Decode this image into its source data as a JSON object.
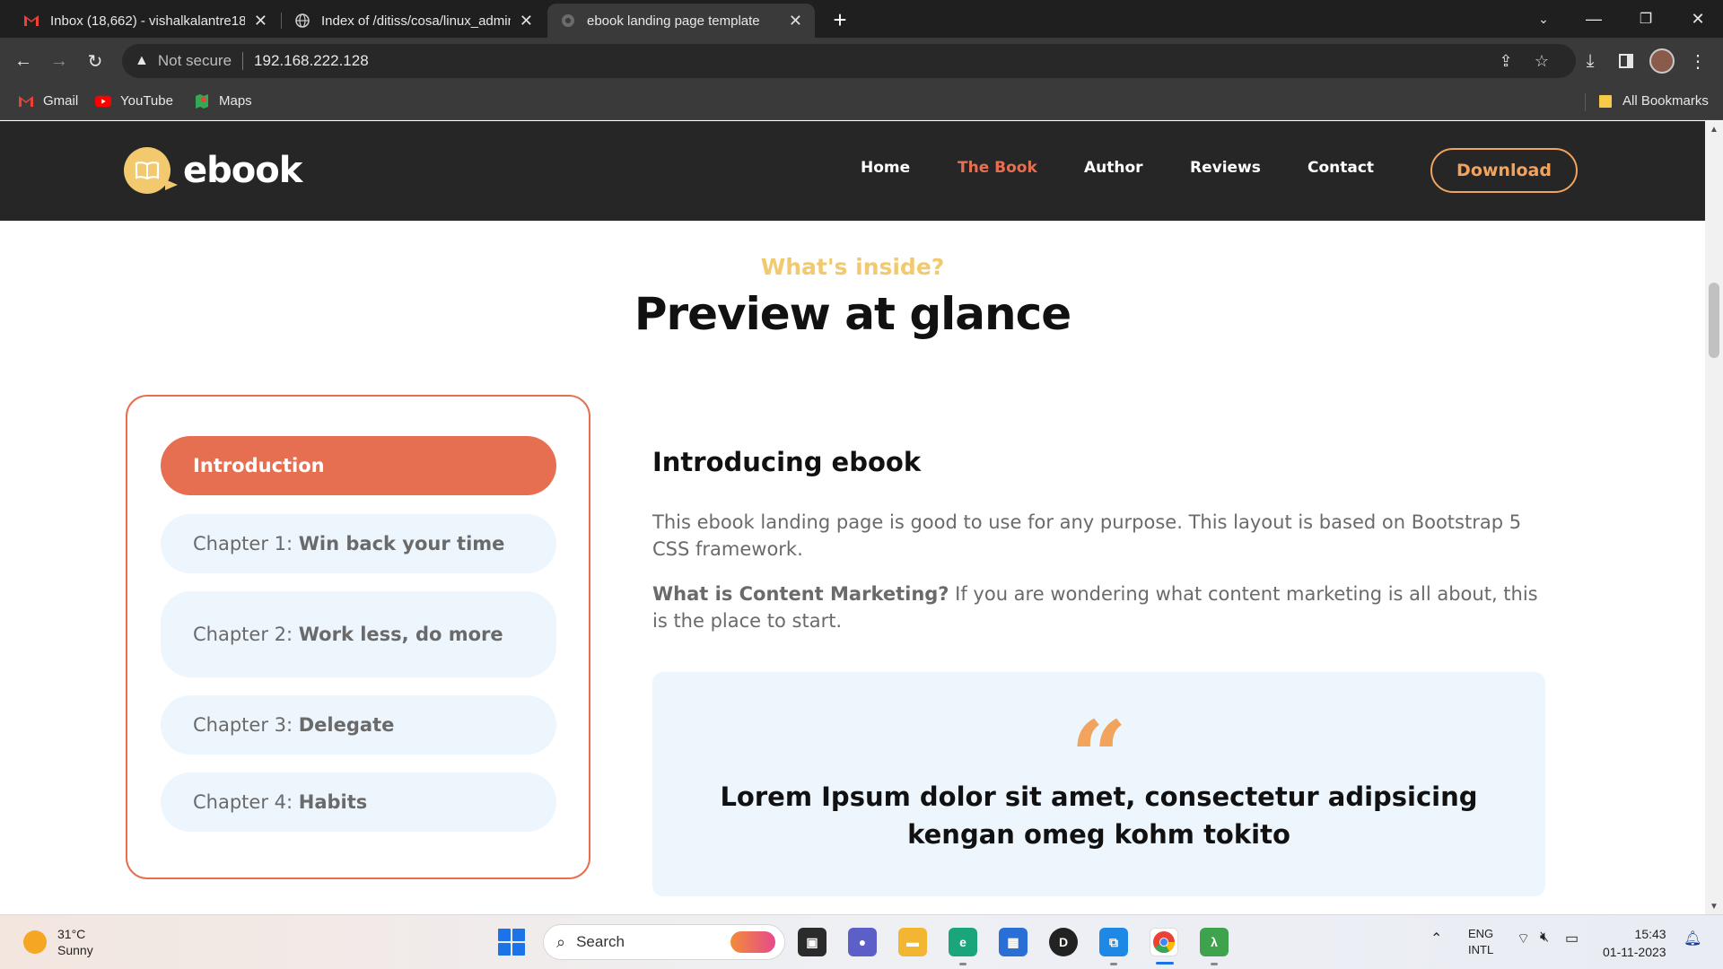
{
  "browser": {
    "tabs": [
      {
        "title": "Inbox (18,662) - vishalkalantre18",
        "favicon": "gmail-icon"
      },
      {
        "title": "Index of /ditiss/cosa/linux_admin",
        "favicon": "globe-icon"
      },
      {
        "title": "ebook landing page template",
        "favicon": "globe-icon"
      }
    ],
    "security_label": "Not secure",
    "url": "192.168.222.128",
    "bookmarks": [
      {
        "label": "Gmail",
        "icon": "gmail-icon"
      },
      {
        "label": "YouTube",
        "icon": "youtube-icon"
      },
      {
        "label": "Maps",
        "icon": "maps-icon"
      }
    ],
    "all_bookmarks_label": "All Bookmarks"
  },
  "site": {
    "logo_text": "ebook",
    "nav": [
      "Home",
      "The Book",
      "Author",
      "Reviews",
      "Contact"
    ],
    "active_nav": "The Book",
    "download_label": "Download",
    "accent": "#e76f51",
    "highlight": "#f2c96e"
  },
  "section": {
    "eyebrow": "What's inside?",
    "headline": "Preview at glance"
  },
  "chapters": [
    {
      "prefix": "",
      "title": "Introduction",
      "active": true
    },
    {
      "prefix": "Chapter 1: ",
      "title": "Win back your time"
    },
    {
      "prefix": "Chapter 2: ",
      "title": "Work less, do more"
    },
    {
      "prefix": "Chapter 3: ",
      "title": "Delegate"
    },
    {
      "prefix": "Chapter 4: ",
      "title": "Habits"
    }
  ],
  "content": {
    "title": "Introducing ebook",
    "para1": "This ebook landing page is good to use for any purpose. This layout is based on Bootstrap 5 CSS framework.",
    "para2_bold": "What is Content Marketing?",
    "para2_rest": " If you are wondering what content marketing is all about, this is the place to start.",
    "quote_mark": "“",
    "quote": "Lorem Ipsum dolor sit amet, consectetur adipsicing kengan omeg kohm tokito"
  },
  "taskbar": {
    "temperature": "31°C",
    "weather": "Sunny",
    "search_placeholder": "Search",
    "lang_top": "ENG",
    "lang_bottom": "INTL",
    "time": "15:43",
    "date": "01-11-2023"
  }
}
